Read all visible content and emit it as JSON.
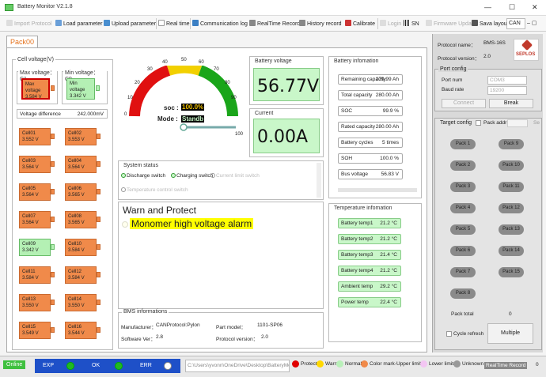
{
  "window": {
    "title": "Battery Monitor V2.1.8",
    "min": "—",
    "max": "☐",
    "close": "✕"
  },
  "toolbar": {
    "items": [
      {
        "label": "Import Protocol",
        "disabled": true
      },
      {
        "label": "Load parameter"
      },
      {
        "label": "Upload parameter"
      },
      {
        "label": "Real time"
      },
      {
        "label": "Communication log"
      },
      {
        "label": "RealTime Record"
      },
      {
        "label": "History record"
      },
      {
        "label": "Calibrate"
      },
      {
        "label": "Login",
        "disabled": true
      },
      {
        "label": "SN"
      },
      {
        "label": "Firmware Update",
        "disabled": true
      },
      {
        "label": "Sava layout"
      }
    ],
    "lang": "CAN"
  },
  "tab": {
    "label": "Pack00"
  },
  "cell_voltage": {
    "title": "Cell voltage(V)",
    "max_label": "Max voltage：C1",
    "min_label": "Min voltage：C9",
    "max_box_label": "Max voltage",
    "max_box_value": "3.584 V",
    "min_box_label": "Min voltage",
    "min_box_value": "3.342 V",
    "diff_label": "Voltage difference",
    "diff_value": "242.000mV",
    "cells": [
      {
        "name": "Cell01",
        "v": "3.552 V"
      },
      {
        "name": "Cell02",
        "v": "3.553 V"
      },
      {
        "name": "Cell03",
        "v": "3.564 V"
      },
      {
        "name": "Cell04",
        "v": "3.564 V"
      },
      {
        "name": "Cell05",
        "v": "3.564 V"
      },
      {
        "name": "Cell06",
        "v": "3.565 V"
      },
      {
        "name": "Cell07",
        "v": "3.564 V"
      },
      {
        "name": "Cell08",
        "v": "3.565 V"
      },
      {
        "name": "Cell09",
        "v": "3.342 V"
      },
      {
        "name": "Cell10",
        "v": "3.584 V"
      },
      {
        "name": "Cell11",
        "v": "3.584 V"
      },
      {
        "name": "Cell12",
        "v": "3.584 V"
      },
      {
        "name": "Cell13",
        "v": "3.550 V"
      },
      {
        "name": "Cell14",
        "v": "3.550 V"
      },
      {
        "name": "Cell15",
        "v": "3.549 V"
      },
      {
        "name": "Cell16",
        "v": "3.544 V"
      }
    ]
  },
  "gauge": {
    "ticks": [
      "0",
      "10",
      "20",
      "30",
      "40",
      "50",
      "60",
      "70",
      "80",
      "90",
      "100"
    ],
    "soc_label": "soc :",
    "soc_value": "100.0%",
    "mode_label": "Mode :",
    "mode_value": "Standb",
    "level": 1.0
  },
  "battery_voltage": {
    "title": "Battery voltage",
    "value": "56.77V"
  },
  "current": {
    "title": "Current",
    "value": "0.00A"
  },
  "system_status": {
    "title": "System status",
    "items": [
      {
        "label": "Discharge switch",
        "on": true
      },
      {
        "label": "Charging switch",
        "on": true
      },
      {
        "label": "Current limit switch",
        "on": false
      },
      {
        "label": "Temperature control switch",
        "on": false
      }
    ]
  },
  "warn": {
    "title": "Warn and Protect",
    "message": "Monomer high voltage alarm"
  },
  "bms_info": {
    "title": "BMS informations",
    "manufacturer_label": "Manufacturer：",
    "manufacturer": "CANProtocol:Pylon",
    "part_label": "Part model：",
    "part": "1101-SP06",
    "software_label": "Software Ver：",
    "software": "2.8",
    "protocol_label": "Protocol version：",
    "protocol": "2.0"
  },
  "battery_info": {
    "title": "Battery infomation",
    "rows": [
      {
        "label": "Remaining capacity",
        "value": "279.99 Ah"
      },
      {
        "label": "Total capacity",
        "value": "280.00 Ah"
      },
      {
        "label": "SOC",
        "value": "99.9 %"
      },
      {
        "label": "Rated capacity",
        "value": "280.00 Ah"
      },
      {
        "label": "Battery cycles",
        "value": "5 times"
      },
      {
        "label": "SOH",
        "value": "100.0 %"
      },
      {
        "label": "Bus voltage",
        "value": "56.83 V"
      }
    ]
  },
  "temperature": {
    "title": "Temperature infomation",
    "rows": [
      {
        "label": "Battery temp1",
        "value": "21.2 °C"
      },
      {
        "label": "Battery temp2",
        "value": "21.2 °C"
      },
      {
        "label": "Battery temp3",
        "value": "21.4 °C"
      },
      {
        "label": "Battery temp4",
        "value": "21.2 °C"
      },
      {
        "label": "Ambient temp",
        "value": "29.2 °C"
      },
      {
        "label": "Power temp",
        "value": "22.4 °C"
      }
    ]
  },
  "side": {
    "protocol_name_label": "Protocol name：",
    "protocol_name": "BMS-16S",
    "protocol_version_label": "Protocol version：",
    "protocol_version": "2.0",
    "logo_text": "SEPLOS",
    "port_title": "Port config",
    "port_num_label": "Port num",
    "port_num": "COM3",
    "baud_label": "Baud rate",
    "baud": "19200",
    "connect": "Connect",
    "break": "Break",
    "target_label": "Target config",
    "pack_addr_label": "Pack addr",
    "se_label": "Se",
    "packs": [
      "Pack 1",
      "Pack 9",
      "Pack 2",
      "Pack 10",
      "Pack 3",
      "Pack 11",
      "Pack 4",
      "Pack 12",
      "Pack 5",
      "Pack 13",
      "Pack 6",
      "Pack 14",
      "Pack 7",
      "Pack 15",
      "Pack 8"
    ],
    "pack_total_label": "Pack total",
    "pack_total": "0",
    "cycle_label": "Cycle refresh",
    "multiple": "Multiple"
  },
  "statusbar": {
    "online": "Online",
    "exp": "EXP",
    "ok": "OK",
    "err": "ERR",
    "path": "C:\\Users\\yvonn\\OneDrive\\Desktop\\BatteryMo",
    "legend": [
      {
        "label": "Protect",
        "color": "#e00000"
      },
      {
        "label": "Warn",
        "color": "#ffd800"
      },
      {
        "label": "Normal",
        "color": "#b9f0b9"
      },
      {
        "label": "Color mark-Upper limit",
        "color": "#f08a4a"
      },
      {
        "label": "Lower limit",
        "color": "#f3c6f3"
      },
      {
        "label": "Unknown",
        "color": "#999999"
      }
    ],
    "realtime": "RealTime Record",
    "count": "0"
  }
}
